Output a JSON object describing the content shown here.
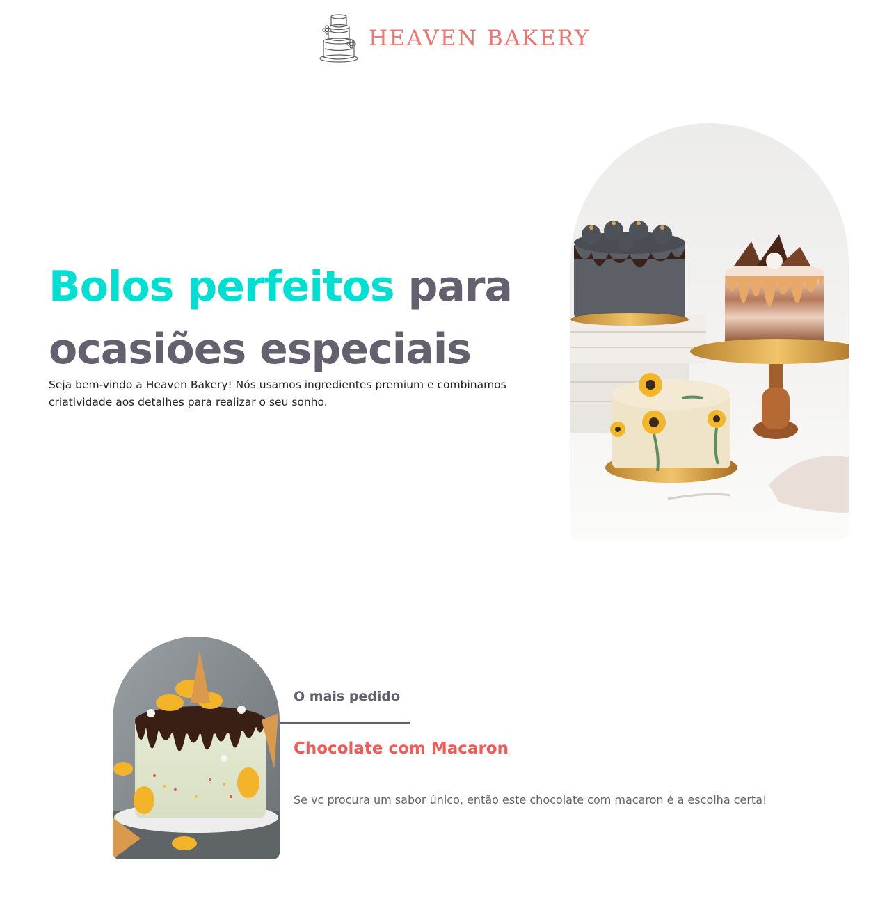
{
  "brand": {
    "name": "HEAVEN BAKERY",
    "logo_icon": "tiered-cake-icon"
  },
  "hero": {
    "title_accent": "Bolos perfeitos",
    "title_rest": " para ocasiões especiais",
    "description": "Seja bem-vindo a Heaven Bakery! Nós usamos ingredientes premium e combinamos criatividade aos detalhes para realizar o seu sonho.",
    "image": "three-decorated-cakes-photo"
  },
  "featured": {
    "eyebrow": "O mais pedido",
    "title": "Chocolate com Macaron",
    "description": "Se vc procura um sabor único, então este chocolate com macaron é a escolha certa!",
    "image": "chocolate-macaron-cake-photo"
  },
  "colors": {
    "accent": "#00dfd1",
    "heading": "#65606d",
    "brand": "#ef7670",
    "feature_title": "#f05b57"
  }
}
